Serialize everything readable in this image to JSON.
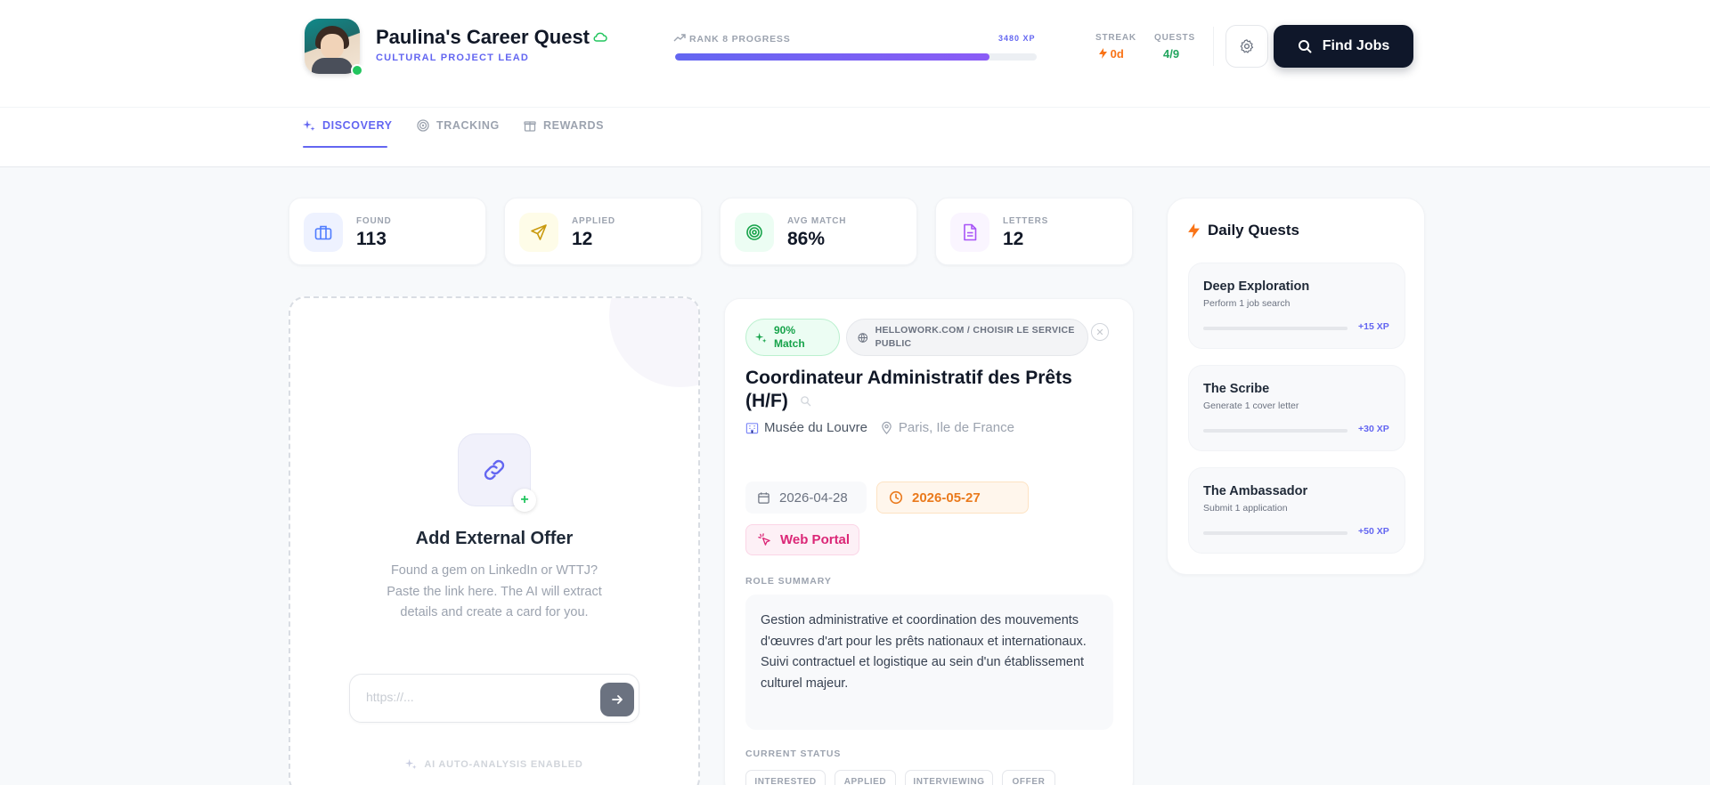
{
  "header": {
    "title": "Paulina's Career Quest",
    "subtitle": "CULTURAL PROJECT LEAD",
    "rank_label": "RANK 8 PROGRESS",
    "xp_label": "3480 XP",
    "progress_fraction": 0.87,
    "streak_label": "STREAK",
    "streak_value": "0d",
    "quests_label": "QUESTS",
    "quests_value": "4/9",
    "find_jobs_label": "Find Jobs"
  },
  "tabs": [
    {
      "label": "DISCOVERY",
      "active": true,
      "icon": "sparkles-icon"
    },
    {
      "label": "TRACKING",
      "active": false,
      "icon": "target-icon"
    },
    {
      "label": "REWARDS",
      "active": false,
      "icon": "gift-icon"
    }
  ],
  "stats": [
    {
      "label": "FOUND",
      "value": "113",
      "icon": "briefcase-icon",
      "color": "#4f7cff"
    },
    {
      "label": "APPLIED",
      "value": "12",
      "icon": "send-icon",
      "color": "#d4a514"
    },
    {
      "label": "AVG MATCH",
      "value": "86%",
      "icon": "target-icon",
      "color": "#16a34a"
    },
    {
      "label": "LETTERS",
      "value": "12",
      "icon": "document-icon",
      "color": "#a855f7"
    }
  ],
  "external_offer": {
    "title": "Add External Offer",
    "description": "Found a gem on LinkedIn or WTTJ? Paste the link here. The AI will extract details and create a card for you.",
    "url_placeholder": "https://...",
    "url_value": "",
    "ai_note": "AI AUTO-ANALYSIS ENABLED"
  },
  "job": {
    "match": "90% Match",
    "source": "HELLOWORK.COM / CHOISIR LE SERVICE PUBLIC",
    "title": "Coordinateur Administratif des Prêts (H/F)",
    "company": "Musée du Louvre",
    "location": "Paris, Ile de France",
    "posted_date": "2026-04-28",
    "deadline_date": "2026-05-27",
    "portal": "Web Portal",
    "summary_label": "ROLE SUMMARY",
    "summary": "Gestion administrative et coordination des mouvements d'œuvres d'art pour les prêts nationaux et internationaux. Suivi contractuel et logistique au sein d'un établissement culturel majeur.",
    "status_label": "CURRENT STATUS",
    "statuses": [
      "INTERESTED",
      "APPLIED",
      "INTERVIEWING",
      "OFFER"
    ]
  },
  "daily_quests": {
    "title": "Daily Quests",
    "items": [
      {
        "name": "Deep Exploration",
        "desc": "Perform 1 job search",
        "xp": "+15 XP",
        "progress": 0
      },
      {
        "name": "The Scribe",
        "desc": "Generate 1 cover letter",
        "xp": "+30 XP",
        "progress": 0
      },
      {
        "name": "The Ambassador",
        "desc": "Submit 1 application",
        "xp": "+50 XP",
        "progress": 0
      }
    ]
  },
  "colors": {
    "accent": "#6366f1",
    "streak": "#f97316",
    "success": "#22c55e",
    "dark_button": "#0f172a"
  }
}
